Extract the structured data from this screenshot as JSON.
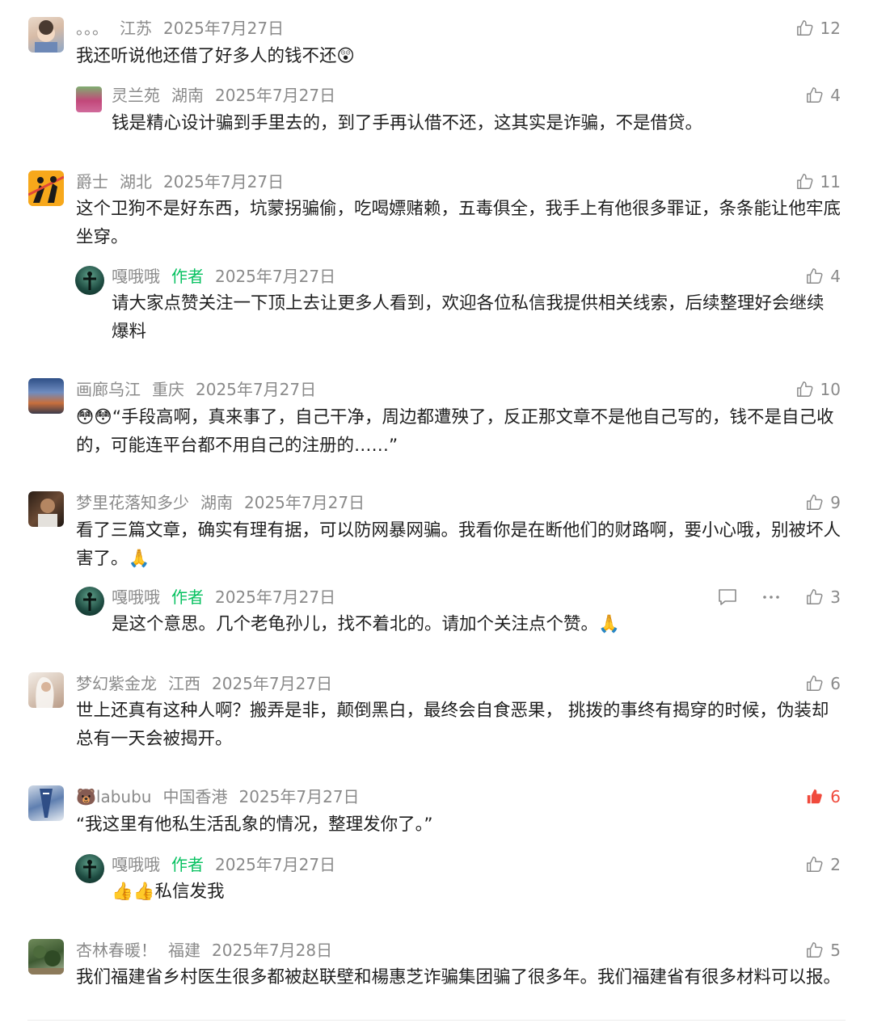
{
  "author_label": "作者",
  "comments": [
    {
      "name": "。。。",
      "location": "江苏",
      "date": "2025年7月27日",
      "text": "我还听说他还借了好多人的钱不还😲",
      "likes": "12"
    },
    {
      "name": "灵兰苑",
      "location": "湖南",
      "date": "2025年7月27日",
      "text": "钱是精心设计骗到手里去的，到了手再认借不还，这其实是诈骗，不是借贷。",
      "likes": "4"
    },
    {
      "name": "爵士",
      "location": "湖北",
      "date": "2025年7月27日",
      "text": "这个卫狗不是好东西，坑蒙拐骗偷，吃喝嫖赌赖，五毒俱全，我手上有他很多罪证，条条能让他牢底坐穿。",
      "likes": "11"
    },
    {
      "name": "嘎哦哦",
      "location": "",
      "date": "2025年7月27日",
      "text": "请大家点赞关注一下顶上去让更多人看到，欢迎各位私信我提供相关线索，后续整理好会继续爆料",
      "likes": "4"
    },
    {
      "name": "画廊乌江",
      "location": "重庆",
      "date": "2025年7月27日",
      "text": "😳😳“手段高啊，真来事了，自己干净，周边都遭殃了，反正那文章不是他自己写的，钱不是自己收的，可能连平台都不用自己的注册的……”",
      "likes": "10"
    },
    {
      "name": "梦里花落知多少",
      "location": "湖南",
      "date": "2025年7月27日",
      "text": "看了三篇文章，确实有理有据，可以防网暴网骗。我看你是在断他们的财路啊，要小心哦，别被坏人害了。🙏",
      "likes": "9"
    },
    {
      "name": "嘎哦哦",
      "location": "",
      "date": "2025年7月27日",
      "text": "是这个意思。几个老龟孙儿，找不着北的。请加个关注点个赞。🙏",
      "likes": "3"
    },
    {
      "name": "梦幻紫金龙",
      "location": "江西",
      "date": "2025年7月27日",
      "text": "世上还真有这种人啊？搬弄是非，颠倒黑白，最终会自食恶果，  挑拨的事终有揭穿的时候，伪装却总有一天会被揭开。",
      "likes": "6"
    },
    {
      "name": "🐻labubu",
      "location": "中国香港",
      "date": "2025年7月27日",
      "text": "“我这里有他私生活乱象的情况，整理发你了。”",
      "likes": "6"
    },
    {
      "name": "嘎哦哦",
      "location": "",
      "date": "2025年7月27日",
      "text": "👍👍私信发我",
      "likes": "2"
    },
    {
      "name": "杏林春暖！",
      "location": "福建",
      "date": "2025年7月28日",
      "text": "我们福建省乡村医生很多都被赵联壁和楊惠芝诈骗集团骗了很多年。我们福建省有很多材料可以报。",
      "likes": "5"
    }
  ],
  "colors": {
    "meta": "#8a8a8a",
    "author": "#07c160",
    "liked": "#f04a3c",
    "text": "#1f1f1f"
  }
}
